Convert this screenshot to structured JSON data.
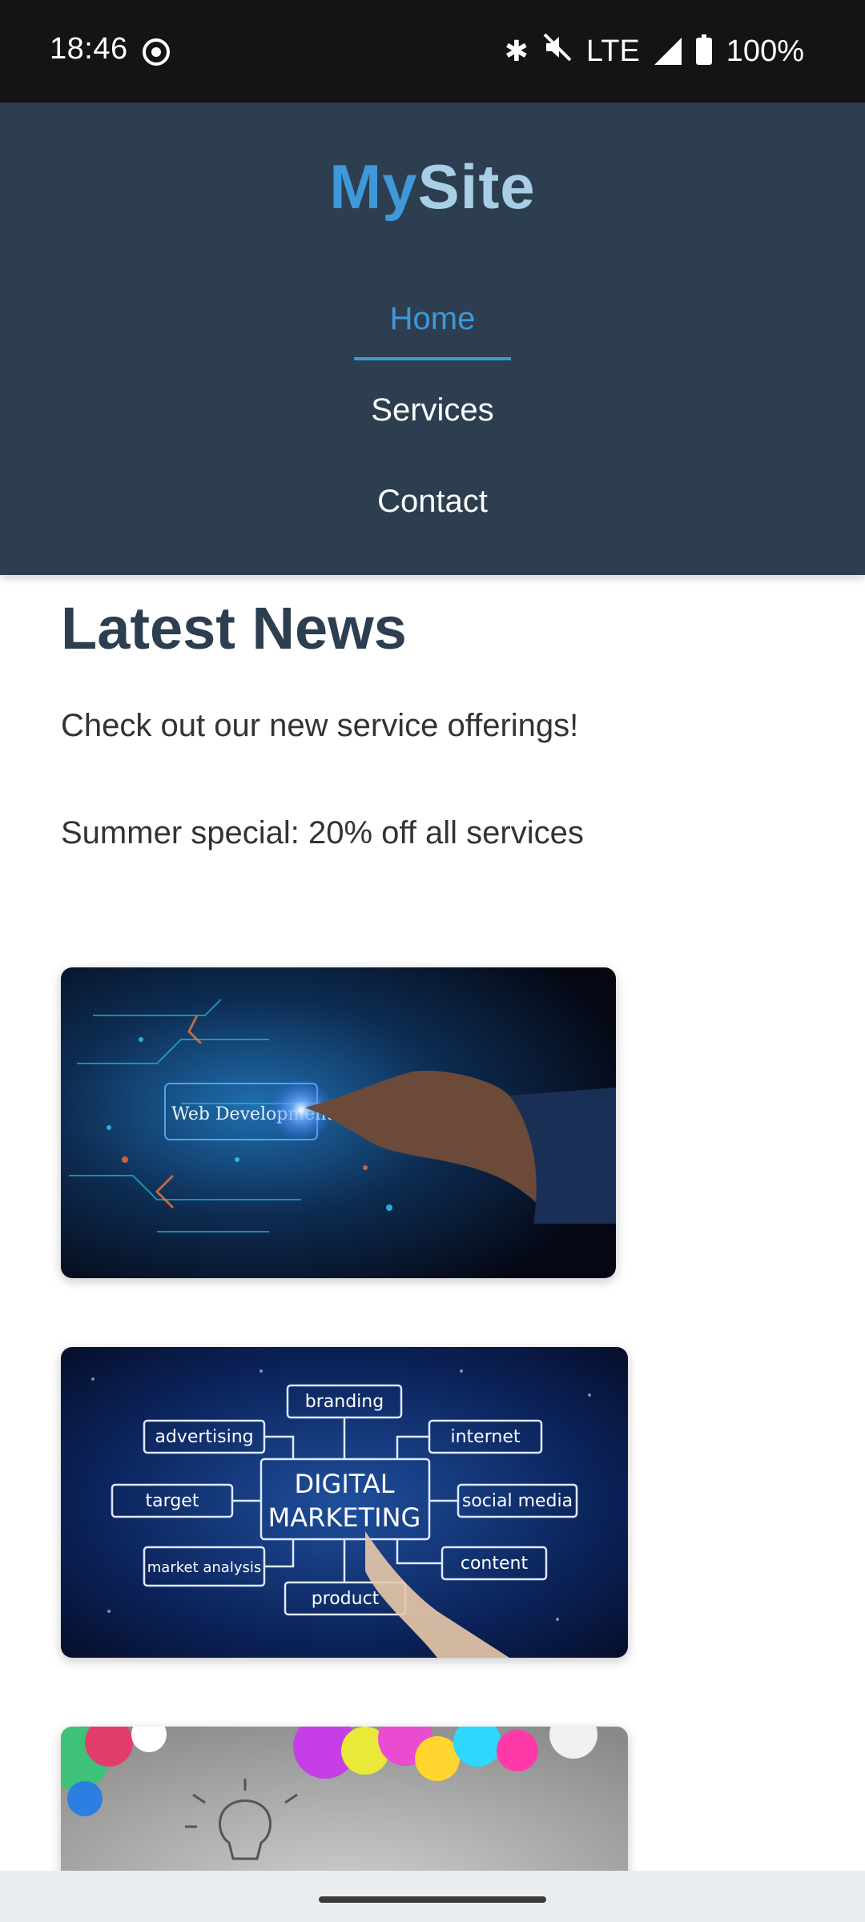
{
  "status_bar": {
    "time": "18:46",
    "network": "LTE",
    "battery": "100%",
    "icons": [
      "screen-record-icon",
      "bluetooth-icon",
      "mute-icon",
      "signal-icon",
      "battery-icon"
    ]
  },
  "header": {
    "logo_part1": "My",
    "logo_part2": "Site",
    "nav": [
      {
        "label": "Home",
        "active": true
      },
      {
        "label": "Services",
        "active": false
      },
      {
        "label": "Contact",
        "active": false
      }
    ]
  },
  "main": {
    "heading": "Latest News",
    "news": [
      "Check out our new service offerings!",
      "Summer special: 20% off all services"
    ],
    "images": [
      {
        "caption_text": "Web Development"
      },
      {
        "center_text_1": "DIGITAL",
        "center_text_2": "MARKETING",
        "tags": [
          "branding",
          "advertising",
          "internet",
          "target",
          "social media",
          "market analysis",
          "content",
          "product"
        ]
      },
      {
        "description": "colorful paint splash with lightbulb sketch"
      }
    ]
  },
  "colors": {
    "header_bg": "#2c3e50",
    "accent": "#3f98d8",
    "heading": "#2c3e50"
  }
}
